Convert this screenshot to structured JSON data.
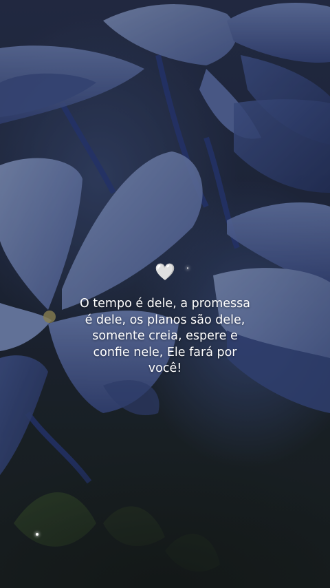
{
  "photo": {
    "subject": "blue-flowers",
    "colors": {
      "petal_light": "#8fa3d6",
      "petal_mid": "#5e74b4",
      "petal_dark": "#34477e",
      "stem": "#2d3f86",
      "leaf": "#3f5a2e",
      "center": "#c8b86a"
    }
  },
  "heart": {
    "glyph": "🤍"
  },
  "quote": {
    "text": "O tempo é dele, a promessa\né dele, os planos são dele,\nsomente creia, espere e\nconfie nele, Ele fará por\nvocê!"
  }
}
